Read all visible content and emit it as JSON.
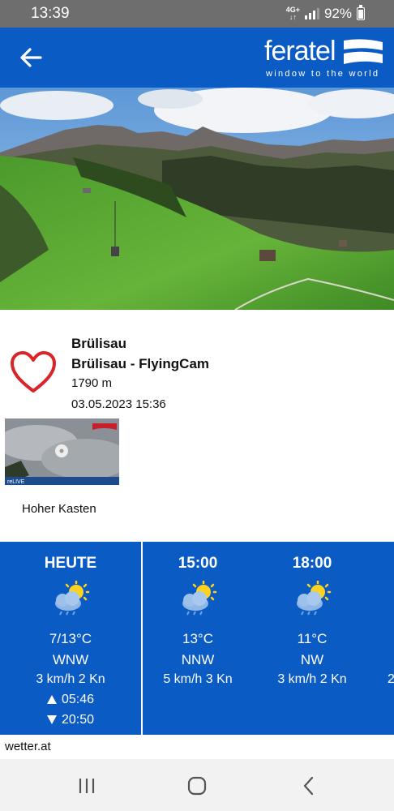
{
  "status_bar": {
    "time": "13:39",
    "network": "4G+",
    "battery": "92%"
  },
  "header": {
    "brand": "feratel",
    "tagline": "window to the world",
    "colors": {
      "primary": "#0a5bc4"
    },
    "icons": {
      "back": "arrow-left-icon",
      "logo": "feratel-flag-logo"
    }
  },
  "webcam": {
    "place": "Brülisau",
    "name": "Brülisau - FlyingCam",
    "altitude": "1790 m",
    "timestamp": "03.05.2023 15:36",
    "favorite_icon": "heart-outline-icon",
    "favorite_color": "#d9252a"
  },
  "related": {
    "thumb_badge": "reLIVE",
    "label": "Hoher Kasten"
  },
  "weather": {
    "columns": [
      {
        "label": "HEUTE",
        "icon": "partly-sunny-rain-icon",
        "temp": "7/13°C",
        "dir": "WNW",
        "wind": "3 km/h 2 Kn",
        "sunrise": "05:46",
        "sunset": "20:50"
      },
      {
        "label": "15:00",
        "icon": "partly-sunny-rain-icon",
        "temp": "13°C",
        "dir": "NNW",
        "wind": "5 km/h 3 Kn"
      },
      {
        "label": "18:00",
        "icon": "partly-sunny-rain-icon",
        "temp": "11°C",
        "dir": "NW",
        "wind": "3 km/h 2 Kn"
      }
    ],
    "clipped_text": "2"
  },
  "source": "wetter.at",
  "nav": {
    "icons": [
      "recent-apps-icon",
      "home-icon",
      "back-icon"
    ]
  }
}
